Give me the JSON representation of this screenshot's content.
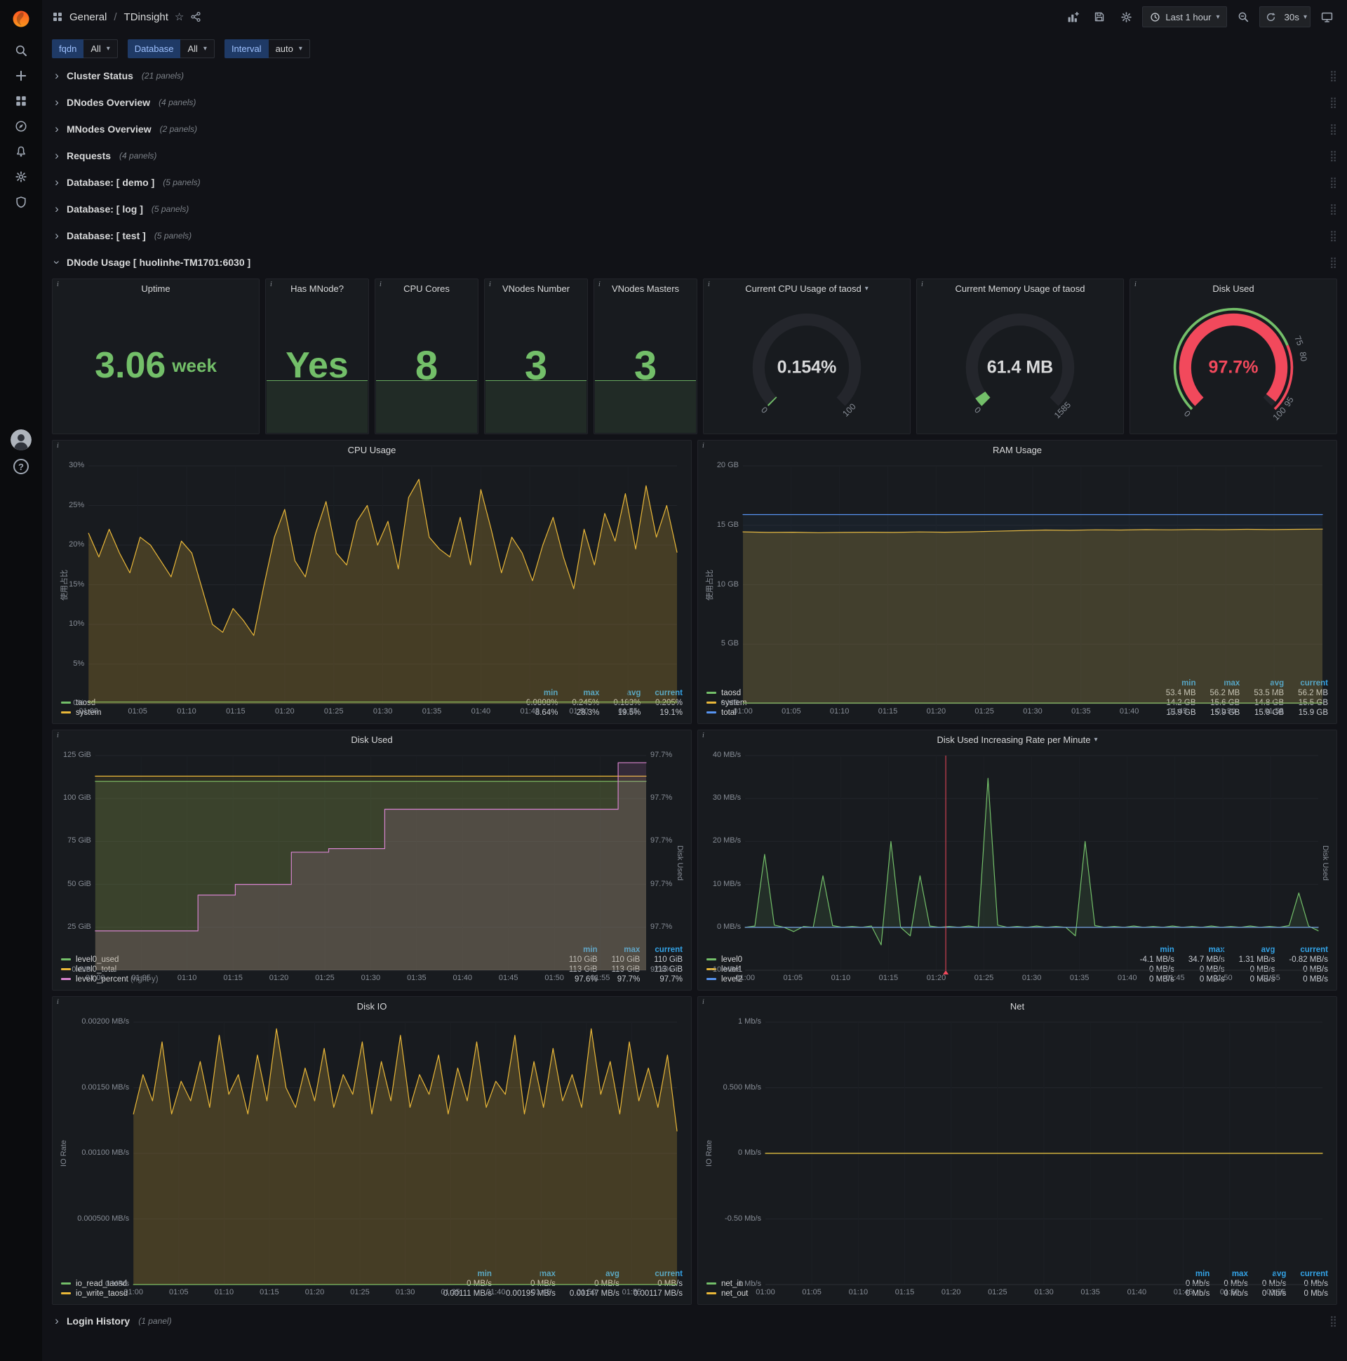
{
  "palette": {
    "green": "#73bf69",
    "yellow": "#eab839",
    "blue": "#5794f2",
    "pink": "#d683ce",
    "red": "#f2495c",
    "legend_header": "#33a2e5"
  },
  "icons": {
    "sidebar": [
      "search-icon",
      "plus-icon",
      "apps-icon",
      "compass-icon",
      "bell-icon",
      "gear-icon",
      "shield-icon",
      "user-avatar",
      "help-icon"
    ],
    "toolbar": [
      "add-panel-icon",
      "save-icon",
      "settings-gear-icon",
      "clock-icon",
      "chevron-down-icon",
      "zoom-out-icon",
      "refresh-icon",
      "tv-icon"
    ],
    "breadcrumb": [
      "apps-icon",
      "star-icon",
      "share-icon"
    ]
  },
  "nav": {
    "breadcrumb": {
      "section": "General",
      "divider": "/",
      "title": "TDinsight"
    },
    "time_picker": {
      "label": "Last 1 hour"
    },
    "refresh": {
      "interval": "30s"
    }
  },
  "variables": [
    {
      "label": "fqdn",
      "value": "All"
    },
    {
      "label": "Database",
      "value": "All"
    },
    {
      "label": "Interval",
      "value": "auto"
    }
  ],
  "rows": [
    {
      "title": "Cluster Status",
      "count": "(21 panels)"
    },
    {
      "title": "DNodes Overview",
      "count": "(4 panels)"
    },
    {
      "title": "MNodes Overview",
      "count": "(2 panels)"
    },
    {
      "title": "Requests",
      "count": "(4 panels)"
    },
    {
      "title": "Database: [ demo ]",
      "count": "(5 panels)"
    },
    {
      "title": "Database: [ log ]",
      "count": "(5 panels)"
    },
    {
      "title": "Database: [ test ]",
      "count": "(5 panels)"
    }
  ],
  "expanded_row": {
    "title": "DNode Usage [ huolinhe-TM1701:6030 ]"
  },
  "footer_row": {
    "title": "Login History",
    "count": "(1 panel)"
  },
  "stats": [
    {
      "title": "Uptime",
      "value": "3.06",
      "unit": "week"
    },
    {
      "title": "Has MNode?",
      "value": "Yes"
    },
    {
      "title": "CPU Cores",
      "value": "8"
    },
    {
      "title": "VNodes Number",
      "value": "3"
    },
    {
      "title": "VNodes Masters",
      "value": "3"
    }
  ],
  "gauges": [
    {
      "title": "Current CPU Usage of taosd",
      "value": "0.154%",
      "value_color": "#d8d9da",
      "fraction": 0.0015,
      "arc_color": "#73bf69",
      "labels": [
        {
          "t": "0",
          "f": 0
        },
        {
          "t": "100",
          "f": 1
        }
      ]
    },
    {
      "title": "Current Memory Usage of taosd",
      "value": "61.4 MB",
      "value_color": "#d8d9da",
      "fraction": 0.039,
      "arc_color": "#73bf69",
      "labels": [
        {
          "t": "0",
          "f": 0
        },
        {
          "t": "1585",
          "f": 1
        }
      ]
    },
    {
      "title": "Disk Used",
      "value": "97.7%",
      "value_color": "#f2495c",
      "fraction": 0.977,
      "arc_color": "#f2495c",
      "band": [
        {
          "from": 0,
          "to": 0.75,
          "color": "#73bf69"
        },
        {
          "from": 0.75,
          "to": 1,
          "color": "#f2495c"
        }
      ],
      "labels": [
        {
          "t": "0",
          "f": 0
        },
        {
          "t": "75",
          "f": 0.75
        },
        {
          "t": "80",
          "f": 0.8
        },
        {
          "t": "95",
          "f": 0.95
        },
        {
          "t": "100",
          "f": 1
        }
      ]
    }
  ],
  "charts": {
    "cpu_usage": {
      "title": "CPU Usage",
      "y_label": "使用占比",
      "ymin": 0,
      "ymax": 30,
      "y_ticks": [
        {
          "v": 30,
          "t": "30%"
        },
        {
          "v": 25,
          "t": "25%"
        },
        {
          "v": 20,
          "t": "20%"
        },
        {
          "v": 15,
          "t": "15%"
        },
        {
          "v": 10,
          "t": "10%"
        },
        {
          "v": 5,
          "t": "5%"
        },
        {
          "v": 0,
          "t": "0%"
        }
      ],
      "x_ticks": [
        "01:00",
        "01:05",
        "01:10",
        "01:15",
        "01:20",
        "01:25",
        "01:30",
        "01:35",
        "01:40",
        "01:45",
        "01:50",
        "01:55"
      ],
      "legend_headers": [
        "min",
        "max",
        "avg",
        "current"
      ],
      "series": [
        {
          "name": "taosd",
          "color": "#73bf69",
          "fill": 0.12,
          "values": [
            0.2,
            0.2,
            0.2,
            0.2,
            0.2,
            0.2,
            0.2,
            0.2,
            0.2,
            0.2,
            0.2,
            0.2
          ],
          "stats": [
            "0.0808%",
            "0.245%",
            "0.183%",
            "0.205%"
          ]
        },
        {
          "name": "system",
          "color": "#eab839",
          "fill": 0.22,
          "values": [
            21.5,
            18.5,
            22,
            19,
            16.5,
            21,
            20,
            18,
            16,
            20.5,
            19,
            14.5,
            10,
            9,
            12,
            10.5,
            8.6,
            15,
            21,
            24.5,
            18,
            16,
            21.5,
            25.5,
            19,
            17.5,
            23,
            25,
            20,
            23,
            17,
            26,
            28.3,
            21,
            19.5,
            18.5,
            23.5,
            17.5,
            27,
            22,
            16.5,
            21,
            19,
            15.5,
            20,
            23.5,
            18.5,
            14.5,
            22,
            17.5,
            24,
            20.5,
            26.5,
            19.5,
            27.5,
            21,
            25,
            19.1
          ],
          "stats": [
            "8.64%",
            "28.3%",
            "19.5%",
            "19.1%"
          ]
        }
      ]
    },
    "ram_usage": {
      "title": "RAM Usage",
      "y_label": "使用占比",
      "ymin": 0,
      "ymax": 20,
      "y_ticks": [
        {
          "v": 20,
          "t": "20 GB"
        },
        {
          "v": 15,
          "t": "15 GB"
        },
        {
          "v": 10,
          "t": "10 GB"
        },
        {
          "v": 5,
          "t": "5 GB"
        },
        {
          "v": 0,
          "t": "0 MB"
        }
      ],
      "x_ticks": [
        "01:00",
        "01:05",
        "01:10",
        "01:15",
        "01:20",
        "01:25",
        "01:30",
        "01:35",
        "01:40",
        "01:45",
        "01:50",
        "01:55"
      ],
      "legend_headers": [
        "min",
        "max",
        "avg",
        "current"
      ],
      "series": [
        {
          "name": "taosd",
          "color": "#73bf69",
          "fill": 0.1,
          "values": [
            0.055,
            0.055,
            0.055,
            0.055,
            0.055,
            0.055,
            0.055,
            0.055,
            0.055,
            0.055,
            0.055,
            0.055
          ],
          "stats": [
            "53.4 MB",
            "56.2 MB",
            "53.5 MB",
            "56.2 MB"
          ]
        },
        {
          "name": "system",
          "color": "#eab839",
          "fill": 0.2,
          "values": [
            14.45,
            14.4,
            14.42,
            14.38,
            14.4,
            14.42,
            14.4,
            14.44,
            14.42,
            14.45,
            14.5,
            14.55,
            14.6,
            14.58,
            14.62,
            14.6,
            14.64,
            14.62,
            14.65,
            14.63,
            14.66,
            14.64,
            14.66,
            14.68
          ],
          "stats": [
            "14.2 GB",
            "15.6 GB",
            "14.8 GB",
            "15.5 GB"
          ]
        },
        {
          "name": "total",
          "color": "#5794f2",
          "fill": 0.05,
          "values": [
            15.9,
            15.9,
            15.9,
            15.9,
            15.9,
            15.9,
            15.9,
            15.9,
            15.9,
            15.9,
            15.9,
            15.9
          ],
          "stats": [
            "15.9 GB",
            "15.9 GB",
            "15.9 GB",
            "15.9 GB"
          ]
        }
      ]
    },
    "disk_used": {
      "title": "Disk Used",
      "ymin": 0,
      "ymax": 125,
      "y_ticks": [
        {
          "v": 125,
          "t": "125 GiB"
        },
        {
          "v": 100,
          "t": "100 GiB"
        },
        {
          "v": 75,
          "t": "75 GiB"
        },
        {
          "v": 50,
          "t": "50 GiB"
        },
        {
          "v": 25,
          "t": "25 GiB"
        },
        {
          "v": 0,
          "t": "0 GiB"
        }
      ],
      "x_ticks": [
        "01:00",
        "01:05",
        "01:10",
        "01:15",
        "01:20",
        "01:25",
        "01:30",
        "01:35",
        "01:40",
        "01:45",
        "01:50",
        "01:55"
      ],
      "right": {
        "label": "Disk Used",
        "min": 97.59,
        "max": 97.71,
        "tick_labels": [
          "97.7%",
          "97.7%",
          "97.7%",
          "97.7%",
          "97.7%",
          "97.6%"
        ]
      },
      "legend_headers": [
        "min",
        "max",
        "current"
      ],
      "series": [
        {
          "name": "level0_used",
          "color": "#73bf69",
          "fill": 0.16,
          "values": [
            110,
            110,
            110,
            110,
            110,
            110,
            110,
            110,
            110,
            110,
            110,
            110
          ],
          "stats": [
            "110 GiB",
            "110 GiB",
            "110 GiB"
          ]
        },
        {
          "name": "level0_total",
          "color": "#eab839",
          "fill": 0.1,
          "values": [
            113,
            113,
            113,
            113,
            113,
            113,
            113,
            113,
            113,
            113,
            113,
            113
          ],
          "stats": [
            "113 GiB",
            "113 GiB",
            "113 GiB"
          ]
        },
        {
          "name": "level0_percent",
          "note": "(right-y)",
          "color": "#d683ce",
          "fill": 0.15,
          "axis": "right",
          "step": true,
          "values": [
            97.612,
            97.612,
            97.612,
            97.612,
            97.612,
            97.612,
            97.612,
            97.612,
            97.612,
            97.612,
            97.612,
            97.632,
            97.632,
            97.632,
            97.632,
            97.638,
            97.638,
            97.638,
            97.638,
            97.638,
            97.638,
            97.656,
            97.656,
            97.656,
            97.656,
            97.658,
            97.658,
            97.658,
            97.658,
            97.658,
            97.658,
            97.68,
            97.68,
            97.68,
            97.68,
            97.68,
            97.68,
            97.68,
            97.68,
            97.68,
            97.68,
            97.68,
            97.68,
            97.68,
            97.68,
            97.68,
            97.68,
            97.68,
            97.68,
            97.68,
            97.68,
            97.68,
            97.68,
            97.68,
            97.68,
            97.68,
            97.706,
            97.706,
            97.706,
            97.706
          ],
          "stats": [
            "97.6%",
            "97.7%",
            "97.7%"
          ]
        }
      ]
    },
    "disk_rate": {
      "title": "Disk Used Increasing Rate per Minute",
      "title_caret": true,
      "ymin": -10,
      "ymax": 40,
      "y_ticks": [
        {
          "v": 40,
          "t": "40 MB/s"
        },
        {
          "v": 30,
          "t": "30 MB/s"
        },
        {
          "v": 20,
          "t": "20 MB/s"
        },
        {
          "v": 10,
          "t": "10 MB/s"
        },
        {
          "v": 0,
          "t": "0 MB/s"
        },
        {
          "v": -10,
          "t": "-10 MB/s"
        }
      ],
      "x_ticks": [
        "01:00",
        "01:05",
        "01:10",
        "01:15",
        "01:20",
        "01:25",
        "01:30",
        "01:35",
        "01:40",
        "01:45",
        "01:50",
        "01:55"
      ],
      "right": {
        "label": "Disk Used"
      },
      "annotations": [
        {
          "x": 0.35
        }
      ],
      "legend_headers": [
        "min",
        "max",
        "avg",
        "current"
      ],
      "series": [
        {
          "name": "level0",
          "color": "#73bf69",
          "fill": 0.12,
          "values": [
            0,
            0.3,
            17,
            0.5,
            0,
            -1,
            0.2,
            0,
            12,
            0.4,
            0,
            0.2,
            0,
            0.3,
            -4.1,
            20,
            0,
            -2,
            12,
            0.3,
            0,
            0.2,
            0,
            0.3,
            0,
            34.7,
            0.5,
            0,
            0.2,
            0,
            0.3,
            0,
            0.2,
            0,
            -2,
            20,
            0.4,
            0,
            0.2,
            0,
            0.3,
            0,
            0.2,
            0,
            0.3,
            0,
            0.2,
            0,
            0.3,
            0,
            0.2,
            0,
            0.3,
            0,
            0.2,
            0,
            0.4,
            8,
            0.3,
            -0.82
          ],
          "stats": [
            "-4.1 MB/s",
            "34.7 MB/s",
            "1.31 MB/s",
            "-0.82 MB/s"
          ]
        },
        {
          "name": "level1",
          "color": "#eab839",
          "fill": 0,
          "values": [
            0,
            0,
            0,
            0,
            0,
            0,
            0,
            0,
            0,
            0,
            0,
            0
          ],
          "stats": [
            "0 MB/s",
            "0 MB/s",
            "0 MB/s",
            "0 MB/s"
          ]
        },
        {
          "name": "level2",
          "color": "#5794f2",
          "fill": 0,
          "values": [
            0,
            0,
            0,
            0,
            0,
            0,
            0,
            0,
            0,
            0,
            0,
            0
          ],
          "stats": [
            "0 MB/s",
            "0 MB/s",
            "0 MB/s",
            "0 MB/s"
          ]
        }
      ]
    },
    "disk_io": {
      "title": "Disk IO",
      "y_label": "IO Rate",
      "ymin": 0,
      "ymax": 0.002,
      "y_ticks": [
        {
          "v": 0.002,
          "t": "0.00200 MB/s"
        },
        {
          "v": 0.0015,
          "t": "0.00150 MB/s"
        },
        {
          "v": 0.001,
          "t": "0.00100 MB/s"
        },
        {
          "v": 0.0005,
          "t": "0.000500 MB/s"
        },
        {
          "v": 0,
          "t": "0 MB/s"
        }
      ],
      "x_ticks": [
        "01:00",
        "01:05",
        "01:10",
        "01:15",
        "01:20",
        "01:25",
        "01:30",
        "01:35",
        "01:40",
        "01:45",
        "01:50",
        "01:55"
      ],
      "legend_headers": [
        "min",
        "max",
        "avg",
        "current"
      ],
      "series": [
        {
          "name": "io_read_taosd",
          "color": "#73bf69",
          "fill": 0,
          "values": [
            0,
            0,
            0,
            0,
            0,
            0,
            0,
            0,
            0,
            0,
            0,
            0
          ],
          "stats": [
            "0 MB/s",
            "0 MB/s",
            "0 MB/s",
            "0 MB/s"
          ]
        },
        {
          "name": "io_write_taosd",
          "color": "#eab839",
          "fill": 0.22,
          "values": [
            0.0013,
            0.0016,
            0.0014,
            0.00185,
            0.0013,
            0.00155,
            0.0014,
            0.0017,
            0.00135,
            0.0019,
            0.00145,
            0.0016,
            0.0013,
            0.00175,
            0.0014,
            0.00195,
            0.0015,
            0.00135,
            0.00165,
            0.0014,
            0.0018,
            0.00135,
            0.0016,
            0.00145,
            0.00185,
            0.0013,
            0.0017,
            0.0014,
            0.0019,
            0.00135,
            0.0016,
            0.00145,
            0.00175,
            0.0013,
            0.00165,
            0.0014,
            0.00185,
            0.00135,
            0.00155,
            0.00145,
            0.0019,
            0.0013,
            0.0017,
            0.00135,
            0.0018,
            0.0014,
            0.0016,
            0.00135,
            0.00195,
            0.00145,
            0.0017,
            0.0013,
            0.00185,
            0.0014,
            0.00165,
            0.00135,
            0.00175,
            0.00117
          ],
          "stats": [
            "0.00111 MB/s",
            "0.00195 MB/s",
            "0.00147 MB/s",
            "0.00117 MB/s"
          ]
        }
      ]
    },
    "net": {
      "title": "Net",
      "y_label": "IO Rate",
      "ymin": -1,
      "ymax": 1,
      "y_ticks": [
        {
          "v": 1,
          "t": "1 Mb/s"
        },
        {
          "v": 0.5,
          "t": "0.500 Mb/s"
        },
        {
          "v": 0,
          "t": "0 Mb/s"
        },
        {
          "v": -0.5,
          "t": "-0.50 Mb/s"
        },
        {
          "v": -1,
          "t": "-1 Mb/s"
        }
      ],
      "x_ticks": [
        "01:00",
        "01:05",
        "01:10",
        "01:15",
        "01:20",
        "01:25",
        "01:30",
        "01:35",
        "01:40",
        "01:45",
        "01:50",
        "01:55"
      ],
      "legend_headers": [
        "min",
        "max",
        "avg",
        "current"
      ],
      "series": [
        {
          "name": "net_in",
          "color": "#73bf69",
          "fill": 0,
          "values": [
            0,
            0,
            0,
            0,
            0,
            0,
            0,
            0,
            0,
            0,
            0,
            0
          ],
          "stats": [
            "0 Mb/s",
            "0 Mb/s",
            "0 Mb/s",
            "0 Mb/s"
          ]
        },
        {
          "name": "net_out",
          "color": "#eab839",
          "fill": 0,
          "values": [
            0,
            0,
            0,
            0,
            0,
            0,
            0,
            0,
            0,
            0,
            0,
            0
          ],
          "stats": [
            "0 Mb/s",
            "0 Mb/s",
            "0 Mb/s",
            "0 Mb/s"
          ]
        }
      ]
    }
  }
}
